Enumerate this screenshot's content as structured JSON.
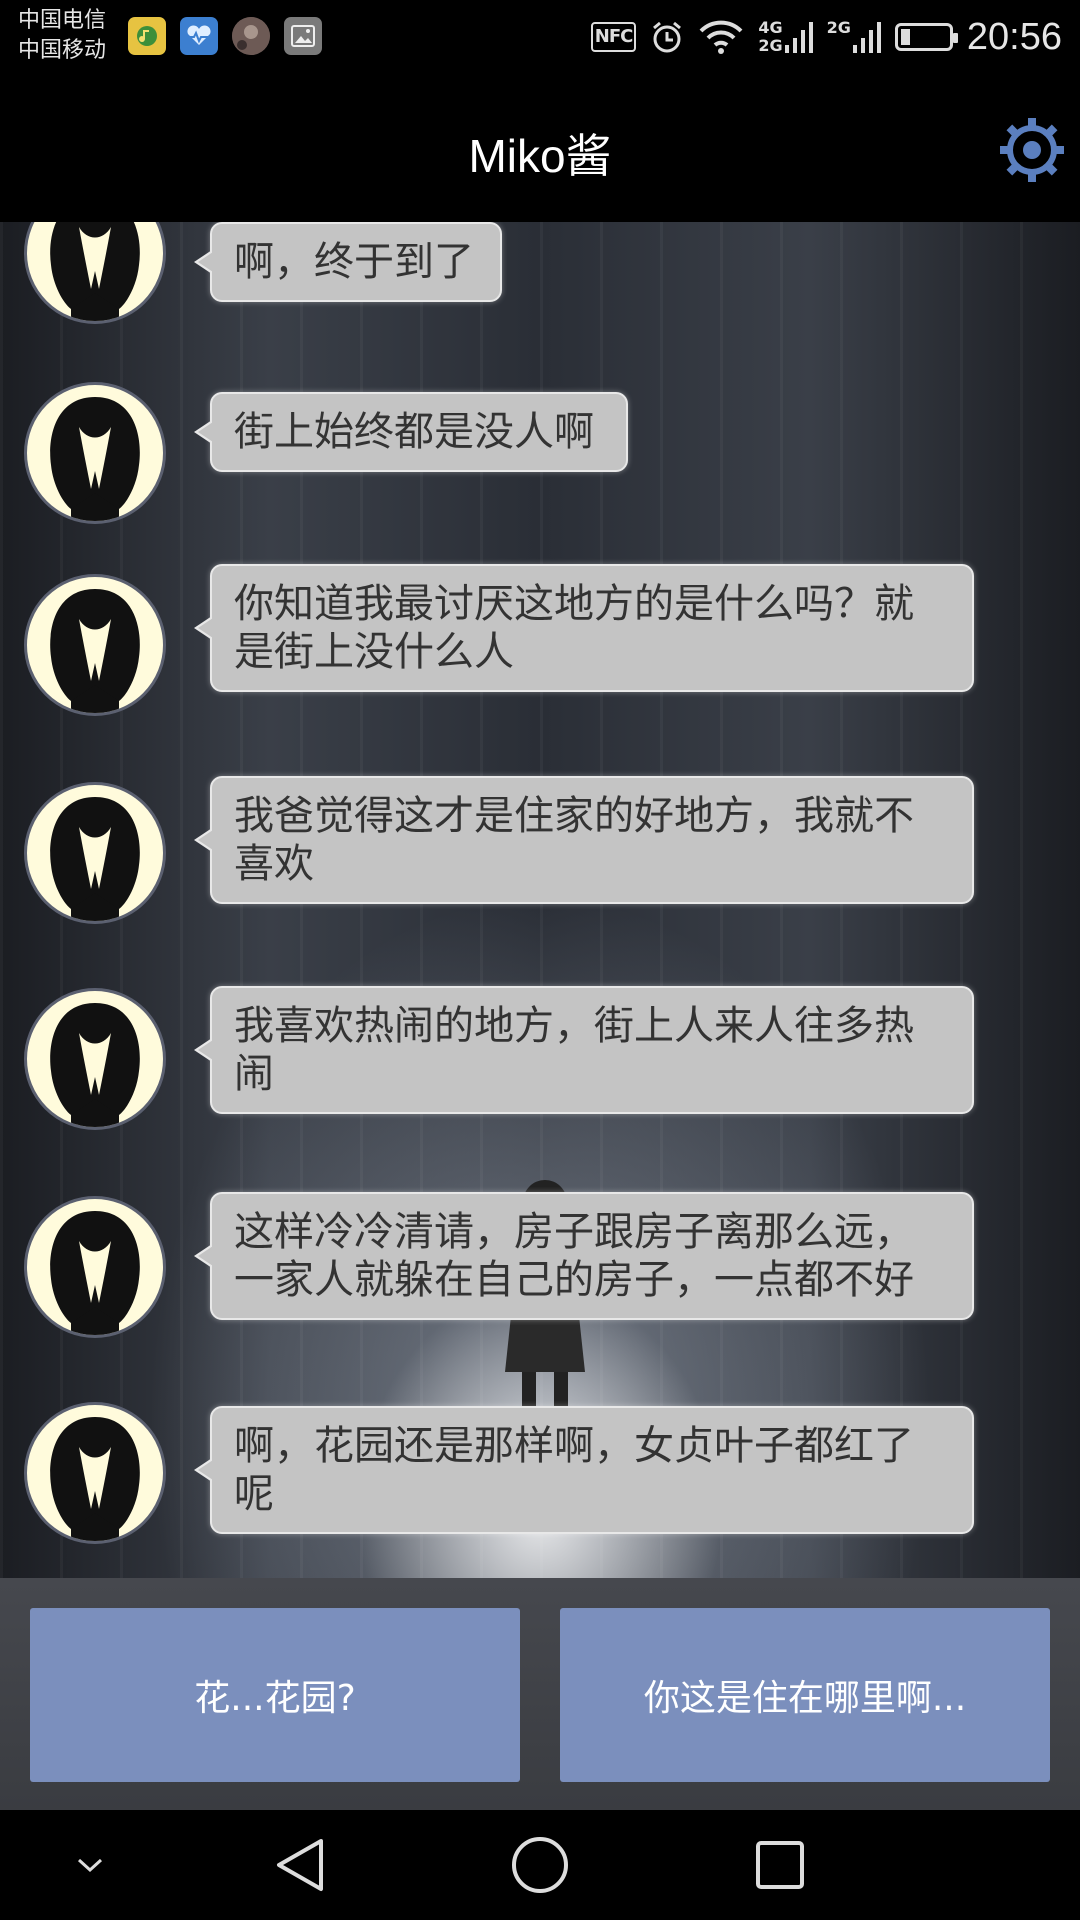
{
  "status_bar": {
    "carriers": [
      "中国电信",
      "中国移动"
    ],
    "notification_icons": [
      "music-app-icon",
      "health-app-icon",
      "avatar-app-icon",
      "gallery-app-icon"
    ],
    "nfc_label": "NFC",
    "network_top": "4G",
    "network_bottom": "2G",
    "network_second": "2G",
    "battery_level": 0.2,
    "time": "20:56"
  },
  "header": {
    "title": "Miko酱",
    "settings_icon": "gear-icon",
    "accent_color": "#5b7fbf"
  },
  "messages": [
    {
      "text": "啊，终于到了"
    },
    {
      "text": "街上始终都是没人啊"
    },
    {
      "text": "你知道我最讨厌这地方的是什么吗？就是街上没什么人"
    },
    {
      "text": "我爸觉得这才是住家的好地方，我就不喜欢"
    },
    {
      "text": "我喜欢热闹的地方，街上人来人往多热闹"
    },
    {
      "text": "这样冷冷清请，房子跟房子离那么远，一家人就躲在自己的房子，一点都不好"
    },
    {
      "text": "啊，花园还是那样啊，女贞叶子都红了呢"
    }
  ],
  "choices": {
    "left": "花...花园?",
    "right": "你这是住在哪里啊..."
  },
  "nav_bar": {
    "icons": [
      "chevron-down-icon",
      "back-icon",
      "home-icon",
      "recents-icon"
    ]
  }
}
